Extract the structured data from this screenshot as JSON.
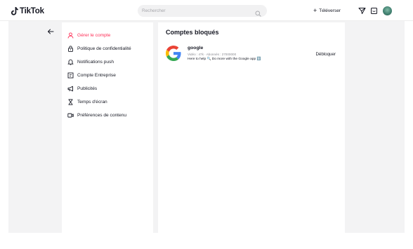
{
  "header": {
    "logo_text": "TikTok",
    "search_placeholder": "Rechercher",
    "upload_label": "Téléverser",
    "upload_plus": "+",
    "icons": [
      "send-icon",
      "inbox-icon"
    ]
  },
  "sidebar": {
    "items": [
      {
        "label": "Gérer le compte",
        "icon": "user-icon",
        "active": true
      },
      {
        "label": "Politique de confidentialité",
        "icon": "lock-icon",
        "active": false
      },
      {
        "label": "Notifications push",
        "icon": "bell-icon",
        "active": false
      },
      {
        "label": "Compte Entreprise",
        "icon": "business-icon",
        "active": false
      },
      {
        "label": "Publicités",
        "icon": "megaphone-icon",
        "active": false
      },
      {
        "label": "Temps d'écran",
        "icon": "hourglass-icon",
        "active": false
      },
      {
        "label": "Préférences de contenu",
        "icon": "video-icon",
        "active": false
      }
    ]
  },
  "main": {
    "title": "Comptes bloqués",
    "blocked": [
      {
        "name": "google",
        "meta": "Vidéo : 47k · Abonnés : 27000000",
        "bio": "Here to help 🔍 Do more with the Google app ⬇️",
        "action": "Débloquer"
      }
    ]
  },
  "colors": {
    "accent": "#fe2c55",
    "page_bg": "#f3f3f4",
    "text": "#161823"
  }
}
